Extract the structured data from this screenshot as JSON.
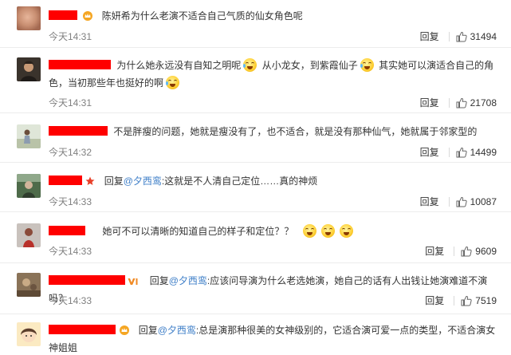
{
  "comments": [
    {
      "text": "陈妍希为什么老演不适合自己气质的仙女角色呢",
      "time": "今天14:31",
      "reply_label": "回复",
      "likes": "31494",
      "badge": "crown",
      "avatar": "blur-face"
    },
    {
      "text_a": "为什么她永远没有自知之明呢",
      "text_b": "从小龙女，到紫霞仙子",
      "text_c": "其实她可以演适合自己的角色，当初那些年也挺好的啊",
      "time": "今天14:31",
      "reply_label": "回复",
      "likes": "21708",
      "avatar": "dark-portrait"
    },
    {
      "text": "不是胖瘦的问题，她就是瘦没有了，也不适合，就是没有那种仙气，她就属于邻家型的",
      "time": "今天14:32",
      "reply_label": "回复",
      "likes": "14499",
      "avatar": "outdoor"
    },
    {
      "reply_prefix": "回复",
      "mention": "@夕西鸾",
      "text": ":这就是不人清自己定位……真的神烦",
      "time": "今天14:33",
      "reply_label": "回复",
      "likes": "10087",
      "badge": "star",
      "avatar": "green-scene"
    },
    {
      "text": "她可不可以清晰的知道自己的样子和定位？？",
      "time": "今天14:33",
      "reply_label": "回复",
      "likes": "9609",
      "avatar": "red-figure"
    },
    {
      "reply_prefix": "回复",
      "mention": "@夕西鸾",
      "text": ":应该问导演为什么老选她演，她自己的话有人出钱让她演难道不演吗？",
      "time": "今天14:33",
      "reply_label": "回复",
      "likes": "7519",
      "badge": "vip",
      "avatar": "brown-photo"
    },
    {
      "reply_prefix": "回复",
      "mention": "@夕西鸾",
      "text": ":总是演那种很美的女神级别的，它适合演可爱一点的类型，不适合演女神姐姐",
      "badge": "crown",
      "avatar": "cartoon-girl"
    }
  ],
  "colors": {
    "redaction": "#ff0000",
    "mention": "#3f7fc8",
    "muted": "#808080",
    "text": "#333333"
  },
  "icons": {
    "like": "thumbs-up-icon",
    "emoji": "laugh-cry-emoji-icon"
  }
}
